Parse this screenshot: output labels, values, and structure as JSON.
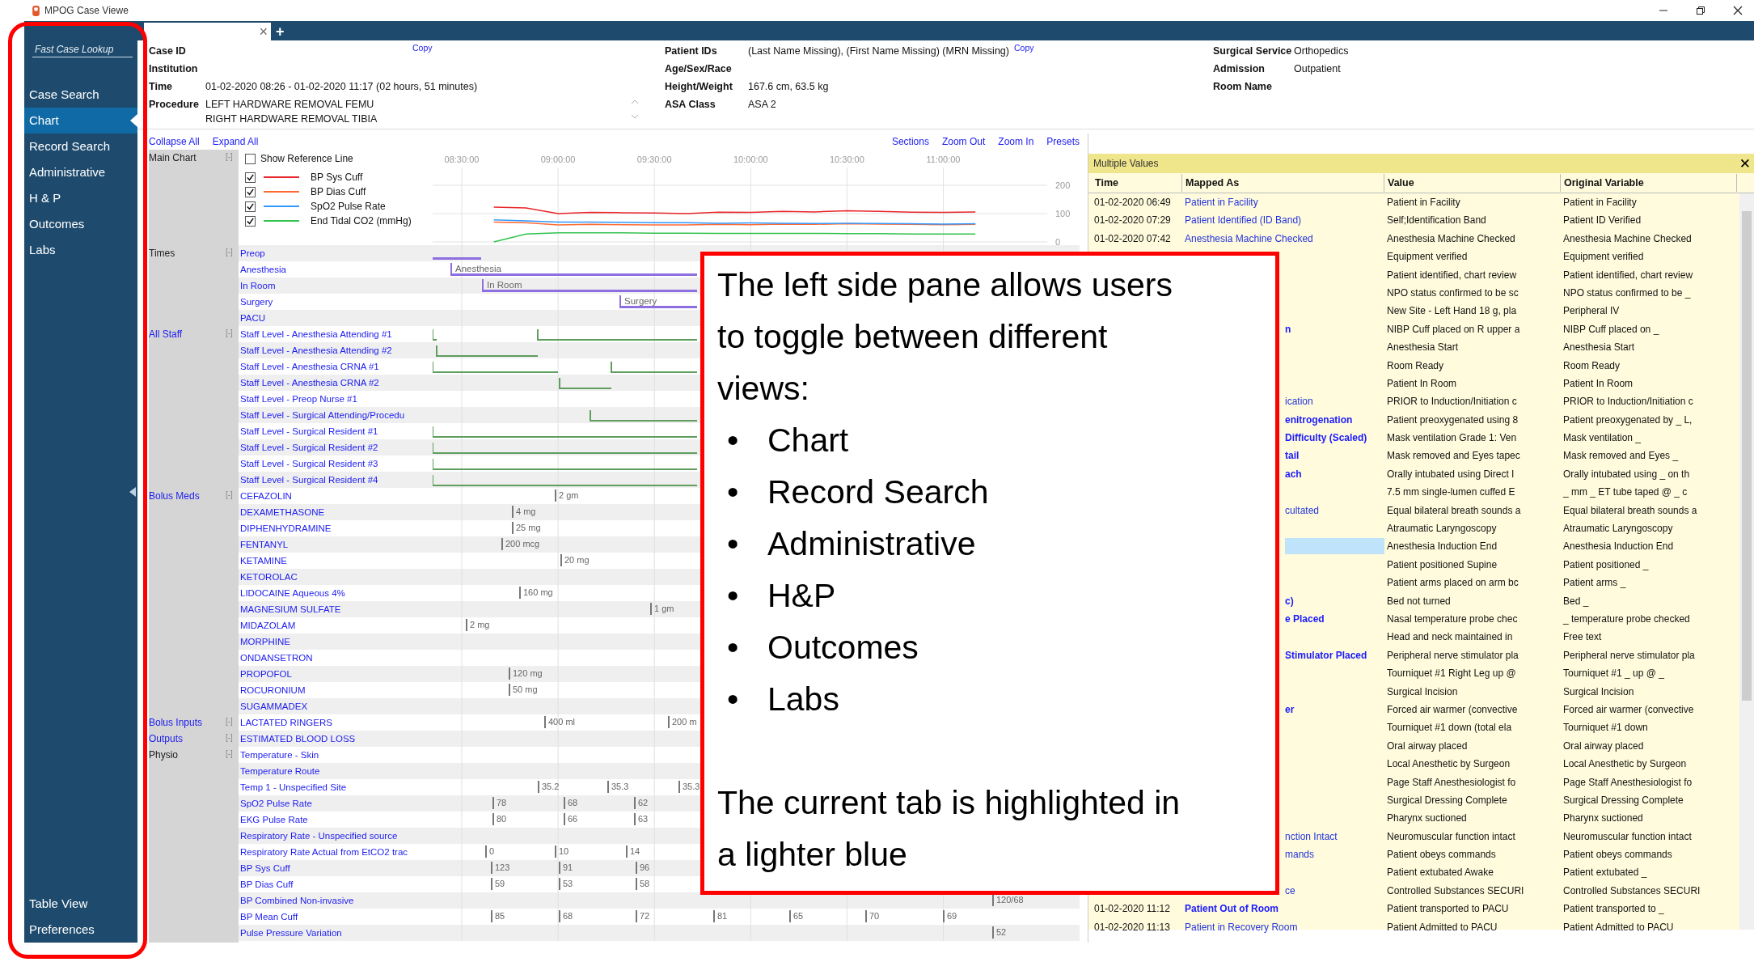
{
  "window": {
    "title": "MPOG Case Viewe"
  },
  "sidebar": {
    "search": {
      "placeholder": "Fast Case Lookup"
    },
    "items": [
      {
        "label": "Case Search",
        "selected": false
      },
      {
        "label": "Chart",
        "selected": true
      },
      {
        "label": "Record Search",
        "selected": false
      },
      {
        "label": "Administrative",
        "selected": false
      },
      {
        "label": "H & P",
        "selected": false
      },
      {
        "label": "Outcomes",
        "selected": false
      },
      {
        "label": "Labs",
        "selected": false
      }
    ],
    "bottom_items": [
      {
        "label": "Table View",
        "selected": false
      },
      {
        "label": "Preferences",
        "selected": false
      }
    ]
  },
  "tab_bar": {
    "close": "×",
    "add": "+"
  },
  "header": {
    "left": [
      {
        "label": "Case ID",
        "copy": "Copy"
      },
      {
        "label": "Institution"
      },
      {
        "label": "Time",
        "value": "01-02-2020 08:26 - 01-02-2020 11:17 (02 hours, 51 minutes)"
      },
      {
        "label": "Procedure",
        "lines": [
          "LEFT HARDWARE REMOVAL FEMU",
          "RIGHT HARDWARE REMOVAL TIBIA"
        ]
      }
    ],
    "middle": [
      {
        "label": "Patient IDs",
        "value": "(Last Name Missing), (First Name Missing) (MRN Missing)",
        "copy": "Copy"
      },
      {
        "label": "Age/Sex/Race"
      },
      {
        "label": "Height/Weight",
        "value": "167.6 cm, 63.5 kg"
      },
      {
        "label": "ASA Class",
        "value": "ASA 2"
      }
    ],
    "right": [
      {
        "label": "Surgical Service",
        "value": "Orthopedics"
      },
      {
        "label": "Admission",
        "value": "Outpatient"
      },
      {
        "label": "Room Name"
      }
    ]
  },
  "chart": {
    "collapse_all": "Collapse All",
    "expand_all": "Expand All",
    "toolbar": [
      "Sections",
      "Zoom Out",
      "Zoom In",
      "Presets"
    ],
    "main_chart": {
      "label": "Main Chart",
      "toggle": "[-]",
      "link": false,
      "reference_line": {
        "label": "Show Reference Line",
        "checked": false
      },
      "legend": [
        {
          "checked": true
        },
        {
          "checked": true
        },
        {
          "checked": true
        },
        {
          "checked": true
        }
      ],
      "chart_data": {
        "type": "line",
        "grid": true,
        "categories": [
          "08:30:00",
          null,
          null,
          "09:00:00",
          null,
          null,
          "09:30:00",
          null,
          null,
          "10:00:00",
          null,
          null,
          "10:30:00",
          null,
          null,
          "11:00:00",
          null
        ],
        "ylim": [
          0,
          200
        ],
        "yticks": [
          0,
          100,
          200
        ],
        "series": [
          {
            "name": "BP Sys Cuff",
            "color": "#e8252a",
            "values": [
              null,
              123,
              120,
              100,
              104,
              103,
              102,
              100,
              105,
              104,
              108,
              106,
              110,
              108,
              105,
              104,
              106
            ]
          },
          {
            "name": "BP Dias Cuff",
            "color": "#ff6a33",
            "values": [
              null,
              70,
              68,
              60,
              62,
              61,
              60,
              60,
              62,
              61,
              63,
              62,
              64,
              63,
              62,
              61,
              62
            ]
          },
          {
            "name": "SpO2 Pulse Rate",
            "color": "#3399ff",
            "values": [
              null,
              78,
              74,
              70,
              70,
              69,
              68,
              68,
              66,
              67,
              66,
              65,
              66,
              65,
              64,
              63,
              64
            ]
          },
          {
            "name": "End Tidal CO2 (mmHg)",
            "color": "#33c24d",
            "values": [
              null,
              0,
              28,
              32,
              32,
              32,
              31,
              31,
              30,
              30,
              30,
              30,
              29,
              29,
              28,
              28,
              28
            ]
          }
        ]
      }
    },
    "groups": [
      {
        "label": "Times",
        "toggle": "[-]",
        "link": false,
        "rows": [
          {
            "label": "Preop",
            "kind": "phase",
            "marks": []
          },
          {
            "label": "Anesthesia",
            "kind": "phase",
            "marks": [
              {
                "text": "Anesthesia"
              }
            ]
          },
          {
            "label": "In Room",
            "kind": "phase",
            "marks": [
              {
                "text": "In Room"
              }
            ]
          },
          {
            "label": "Surgery",
            "kind": "phase",
            "marks": [
              {
                "text": "Surgery"
              }
            ]
          },
          {
            "label": "PACU",
            "kind": "phase",
            "marks": []
          }
        ]
      },
      {
        "label": "All Staff",
        "toggle": "[-]",
        "link": true,
        "rows": [
          {
            "label": "Staff Level - Anesthesia Attending #1",
            "kind": "staff",
            "marks": []
          },
          {
            "label": "Staff Level - Anesthesia Attending #2",
            "kind": "staff",
            "marks": []
          },
          {
            "label": "Staff Level - Anesthesia CRNA #1",
            "kind": "staff",
            "marks": []
          },
          {
            "label": "Staff Level - Anesthesia CRNA #2",
            "kind": "staff",
            "marks": []
          },
          {
            "label": "Staff Level - Preop Nurse #1",
            "kind": "staff",
            "marks": []
          },
          {
            "label": "Staff Level - Surgical Attending/Procedu",
            "kind": "staff",
            "marks": []
          },
          {
            "label": "Staff Level - Surgical Resident #1",
            "kind": "staff",
            "marks": []
          },
          {
            "label": "Staff Level - Surgical Resident #2",
            "kind": "staff",
            "marks": []
          },
          {
            "label": "Staff Level - Surgical Resident #3",
            "kind": "staff",
            "marks": []
          },
          {
            "label": "Staff Level - Surgical Resident #4",
            "kind": "staff",
            "marks": []
          }
        ]
      },
      {
        "label": "Bolus Meds",
        "toggle": "[-]",
        "link": true,
        "rows": [
          {
            "label": "CEFAZOLIN",
            "kind": "mark",
            "marks": [
              {
                "text": "2 gm"
              }
            ]
          },
          {
            "label": "DEXAMETHASONE",
            "kind": "mark",
            "marks": [
              {
                "text": "4 mg"
              }
            ]
          },
          {
            "label": "DIPHENHYDRAMINE",
            "kind": "mark",
            "marks": [
              {
                "text": "25 mg"
              }
            ]
          },
          {
            "label": "FENTANYL",
            "kind": "mark",
            "marks": [
              {
                "text": "200 mcg"
              }
            ]
          },
          {
            "label": "KETAMINE",
            "kind": "mark",
            "marks": [
              {
                "text": "20 mg"
              }
            ]
          },
          {
            "label": "KETOROLAC",
            "kind": "mark",
            "marks": []
          },
          {
            "label": "LIDOCAINE Aqueous 4%",
            "kind": "mark",
            "marks": [
              {
                "text": "160 mg"
              }
            ]
          },
          {
            "label": "MAGNESIUM SULFATE",
            "kind": "mark",
            "marks": [
              {
                "text": "1 gm"
              }
            ]
          },
          {
            "label": "MIDAZOLAM",
            "kind": "mark",
            "marks": [
              {
                "text": "2 mg"
              }
            ]
          },
          {
            "label": "MORPHINE",
            "kind": "mark",
            "marks": []
          },
          {
            "label": "ONDANSETRON",
            "kind": "mark",
            "marks": []
          },
          {
            "label": "PROPOFOL",
            "kind": "mark",
            "marks": [
              {
                "text": "120 mg"
              }
            ]
          },
          {
            "label": "ROCURONIUM",
            "kind": "mark",
            "marks": [
              {
                "text": "50 mg"
              }
            ]
          },
          {
            "label": "SUGAMMADEX",
            "kind": "mark",
            "marks": []
          }
        ]
      },
      {
        "label": "Bolus Inputs",
        "toggle": "[-]",
        "link": true,
        "rows": [
          {
            "label": "LACTATED RINGERS",
            "kind": "mark",
            "marks": [
              {
                "text": "400 ml"
              },
              {
                "text": "200 m"
              }
            ]
          }
        ]
      },
      {
        "label": "Outputs",
        "toggle": "[-]",
        "link": true,
        "rows": [
          {
            "label": "ESTIMATED BLOOD LOSS",
            "kind": "mark",
            "marks": []
          }
        ]
      },
      {
        "label": "Physio",
        "toggle": "[-]",
        "link": false,
        "rows": [
          {
            "label": "Temperature - Skin",
            "kind": "mark",
            "marks": []
          },
          {
            "label": "Temperature Route",
            "kind": "mark",
            "marks": []
          },
          {
            "label": "Temp 1 - Unspecified Site",
            "kind": "mark",
            "marks": [
              {
                "text": "35.2"
              },
              {
                "text": "35.3"
              },
              {
                "text": "35.3"
              }
            ]
          },
          {
            "label": "SpO2 Pulse Rate",
            "kind": "mark",
            "marks": [
              {
                "text": "78"
              },
              {
                "text": "68"
              },
              {
                "text": "62"
              }
            ]
          },
          {
            "label": "EKG Pulse Rate",
            "kind": "mark",
            "marks": [
              {
                "text": "80"
              },
              {
                "text": "66"
              },
              {
                "text": "63"
              }
            ]
          },
          {
            "label": "Respiratory Rate - Unspecified source",
            "kind": "mark",
            "marks": []
          },
          {
            "label": "Respiratory Rate Actual from EtCO2 trac",
            "kind": "mark",
            "marks": [
              {
                "text": "0"
              },
              {
                "text": "10"
              },
              {
                "text": "14"
              }
            ]
          },
          {
            "label": "BP Sys Cuff",
            "kind": "mark",
            "marks": [
              {
                "text": "123"
              },
              {
                "text": "91"
              },
              {
                "text": "96"
              }
            ]
          },
          {
            "label": "BP Dias Cuff",
            "kind": "mark",
            "marks": [
              {
                "text": "59"
              },
              {
                "text": "53"
              },
              {
                "text": "58"
              }
            ]
          },
          {
            "label": "BP Combined Non-invasive",
            "kind": "mark",
            "marks": [
              {
                "text": "120/68"
              }
            ]
          },
          {
            "label": "BP Mean Cuff",
            "kind": "mark",
            "marks": [
              {
                "text": "85"
              },
              {
                "text": "68"
              },
              {
                "text": "72"
              },
              {
                "text": "81"
              },
              {
                "text": "65"
              },
              {
                "text": "70"
              },
              {
                "text": "69"
              }
            ]
          },
          {
            "label": "Pulse Pressure Variation",
            "kind": "mark",
            "marks": [
              {
                "text": "52"
              }
            ]
          }
        ]
      }
    ]
  },
  "pane": {
    "title": "Multiple Values",
    "close": "✕",
    "columns": [
      "Time",
      "Mapped As",
      "Value",
      "Original Variable"
    ],
    "rows": [
      {
        "time": "01-02-2020 06:49",
        "mapped": "Patient in Facility",
        "bold": false,
        "value": "Patient in Facility",
        "original": "Patient in Facility",
        "selected": false
      },
      {
        "time": "01-02-2020 07:29",
        "mapped": "Patient Identified (ID Band)",
        "bold": false,
        "value": "Self;Identification Band",
        "original": "Patient ID Verified",
        "selected": false
      },
      {
        "time": "01-02-2020 07:42",
        "mapped": "Anesthesia Machine Checked",
        "bold": false,
        "value": "Anesthesia Machine Checked",
        "original": "Anesthesia Machine Checked",
        "selected": false
      },
      {
        "value": "Equipment verified",
        "original": "Equipment verified",
        "selected": false
      },
      {
        "value": "Patient identified, chart review",
        "original": "Patient identified, chart review",
        "selected": false
      },
      {
        "value": "NPO status confirmed to be sc",
        "original": "NPO status confirmed to be _",
        "selected": false
      },
      {
        "value": "New Site - Left Hand 18 g, pla",
        "original": "Peripheral IV",
        "selected": false
      },
      {
        "mapped": "n",
        "bold": true,
        "value": "NIBP Cuff placed on R upper a",
        "original": "NIBP Cuff placed on _",
        "selected": false
      },
      {
        "value": "Anesthesia Start",
        "original": "Anesthesia Start",
        "selected": false
      },
      {
        "value": "Room Ready",
        "original": "Room Ready",
        "selected": false
      },
      {
        "value": "Patient In Room",
        "original": "Patient In Room",
        "selected": false
      },
      {
        "mapped": "ication",
        "bold": false,
        "value": "PRIOR to Induction/Initiation c",
        "original": "PRIOR to Induction/Initiation c",
        "selected": false
      },
      {
        "mapped": "enitrogenation",
        "bold": true,
        "value": "Patient preoxygenated using 8",
        "original": "Patient preoxygenated by _ L,",
        "selected": false
      },
      {
        "mapped": "Difficulty (Scaled)",
        "bold": true,
        "value": "Mask ventilation Grade 1: Ven",
        "original": "Mask ventilation _",
        "selected": false
      },
      {
        "mapped": "tail",
        "bold": true,
        "value": "Mask removed and Eyes tapec",
        "original": "Mask removed and Eyes _",
        "selected": false
      },
      {
        "mapped": "ach",
        "bold": true,
        "value": "Orally intubated using Direct I",
        "original": "Orally intubated using _ on th",
        "selected": false
      },
      {
        "value": "7.5 mm single-lumen cuffed E",
        "original": "_ mm _ ET tube taped @ _ c",
        "selected": false
      },
      {
        "mapped": "cultated",
        "bold": false,
        "value": "Equal bilateral breath sounds a",
        "original": "Equal bilateral breath sounds a",
        "selected": false
      },
      {
        "value": "Atraumatic Laryngoscopy",
        "original": "Atraumatic Laryngoscopy",
        "selected": false
      },
      {
        "value": "Anesthesia Induction End",
        "original": "Anesthesia Induction End",
        "selected": true
      },
      {
        "value": "Patient positioned Supine",
        "original": "Patient positioned _",
        "selected": false
      },
      {
        "value": "Patient arms placed on arm bc",
        "original": "Patient arms _",
        "selected": false
      },
      {
        "mapped": "c)",
        "bold": true,
        "value": "Bed not turned",
        "original": "Bed _",
        "selected": false
      },
      {
        "mapped": "e Placed",
        "bold": true,
        "value": "Nasal temperature probe chec",
        "original": "_ temperature probe checked",
        "selected": false
      },
      {
        "value": "Head and neck maintained in",
        "original": "Free text",
        "selected": false
      },
      {
        "mapped": "Stimulator Placed",
        "bold": true,
        "value": "Peripheral nerve stimulator pla",
        "original": "Peripheral nerve stimulator pla",
        "selected": false
      },
      {
        "value": "Tourniquet #1 Right Leg up @",
        "original": "Tourniquet #1 _ up @ _",
        "selected": false
      },
      {
        "value": "Surgical Incision",
        "original": "Surgical Incision",
        "selected": false
      },
      {
        "mapped": "er",
        "bold": true,
        "value": "Forced air warmer (convective",
        "original": "Forced air warmer (convective",
        "selected": false
      },
      {
        "value": "Tourniquet #1 down (total ela",
        "original": "Tourniquet #1 down",
        "selected": false
      },
      {
        "value": "Oral airway placed",
        "original": "Oral airway placed",
        "selected": false
      },
      {
        "value": "Local Anesthetic by Surgeon",
        "original": "Local Anesthetic by Surgeon",
        "selected": false
      },
      {
        "value": "Page Staff Anesthesiologist fo",
        "original": "Page Staff Anesthesiologist fo",
        "selected": false
      },
      {
        "value": "Surgical Dressing Complete",
        "original": "Surgical Dressing Complete",
        "selected": false
      },
      {
        "value": "Pharynx suctioned",
        "original": "Pharynx suctioned",
        "selected": false
      },
      {
        "mapped": "nction Intact",
        "bold": false,
        "value": "Neuromuscular function intact",
        "original": "Neuromuscular function intact",
        "selected": false
      },
      {
        "mapped": "mands",
        "bold": false,
        "value": "Patient obeys commands",
        "original": "Patient obeys commands",
        "selected": false
      },
      {
        "value": "Patient extubated Awake",
        "original": "Patient extubated _",
        "selected": false
      },
      {
        "mapped": "ce",
        "bold": false,
        "value": "Controlled Substances SECURI",
        "original": "Controlled Substances SECURI",
        "selected": false
      },
      {
        "time": "01-02-2020 11:12",
        "mapped": "Patient Out of Room",
        "bold": true,
        "value": "Patient transported to PACU",
        "original": "Patient transported to _",
        "selected": false
      },
      {
        "time": "01-02-2020 11:13",
        "mapped": "Patient in Recovery Room",
        "bold": false,
        "value": "Patient Admitted to PACU",
        "original": "Patient Admitted to PACU",
        "selected": false
      }
    ]
  },
  "callout": {
    "text": "The left side pane allows users to toggle between different views:",
    "bullets": [
      {
        "mark": "•",
        "text": "Chart"
      },
      {
        "mark": "•",
        "text": "Record Search"
      },
      {
        "mark": "•",
        "text": "Administrative"
      },
      {
        "mark": "•",
        "text": "H&P"
      },
      {
        "mark": "•",
        "text": "Outcomes"
      },
      {
        "mark": "•",
        "text": "Labs"
      }
    ],
    "note": "The current tab is highlighted in a lighter blue"
  }
}
